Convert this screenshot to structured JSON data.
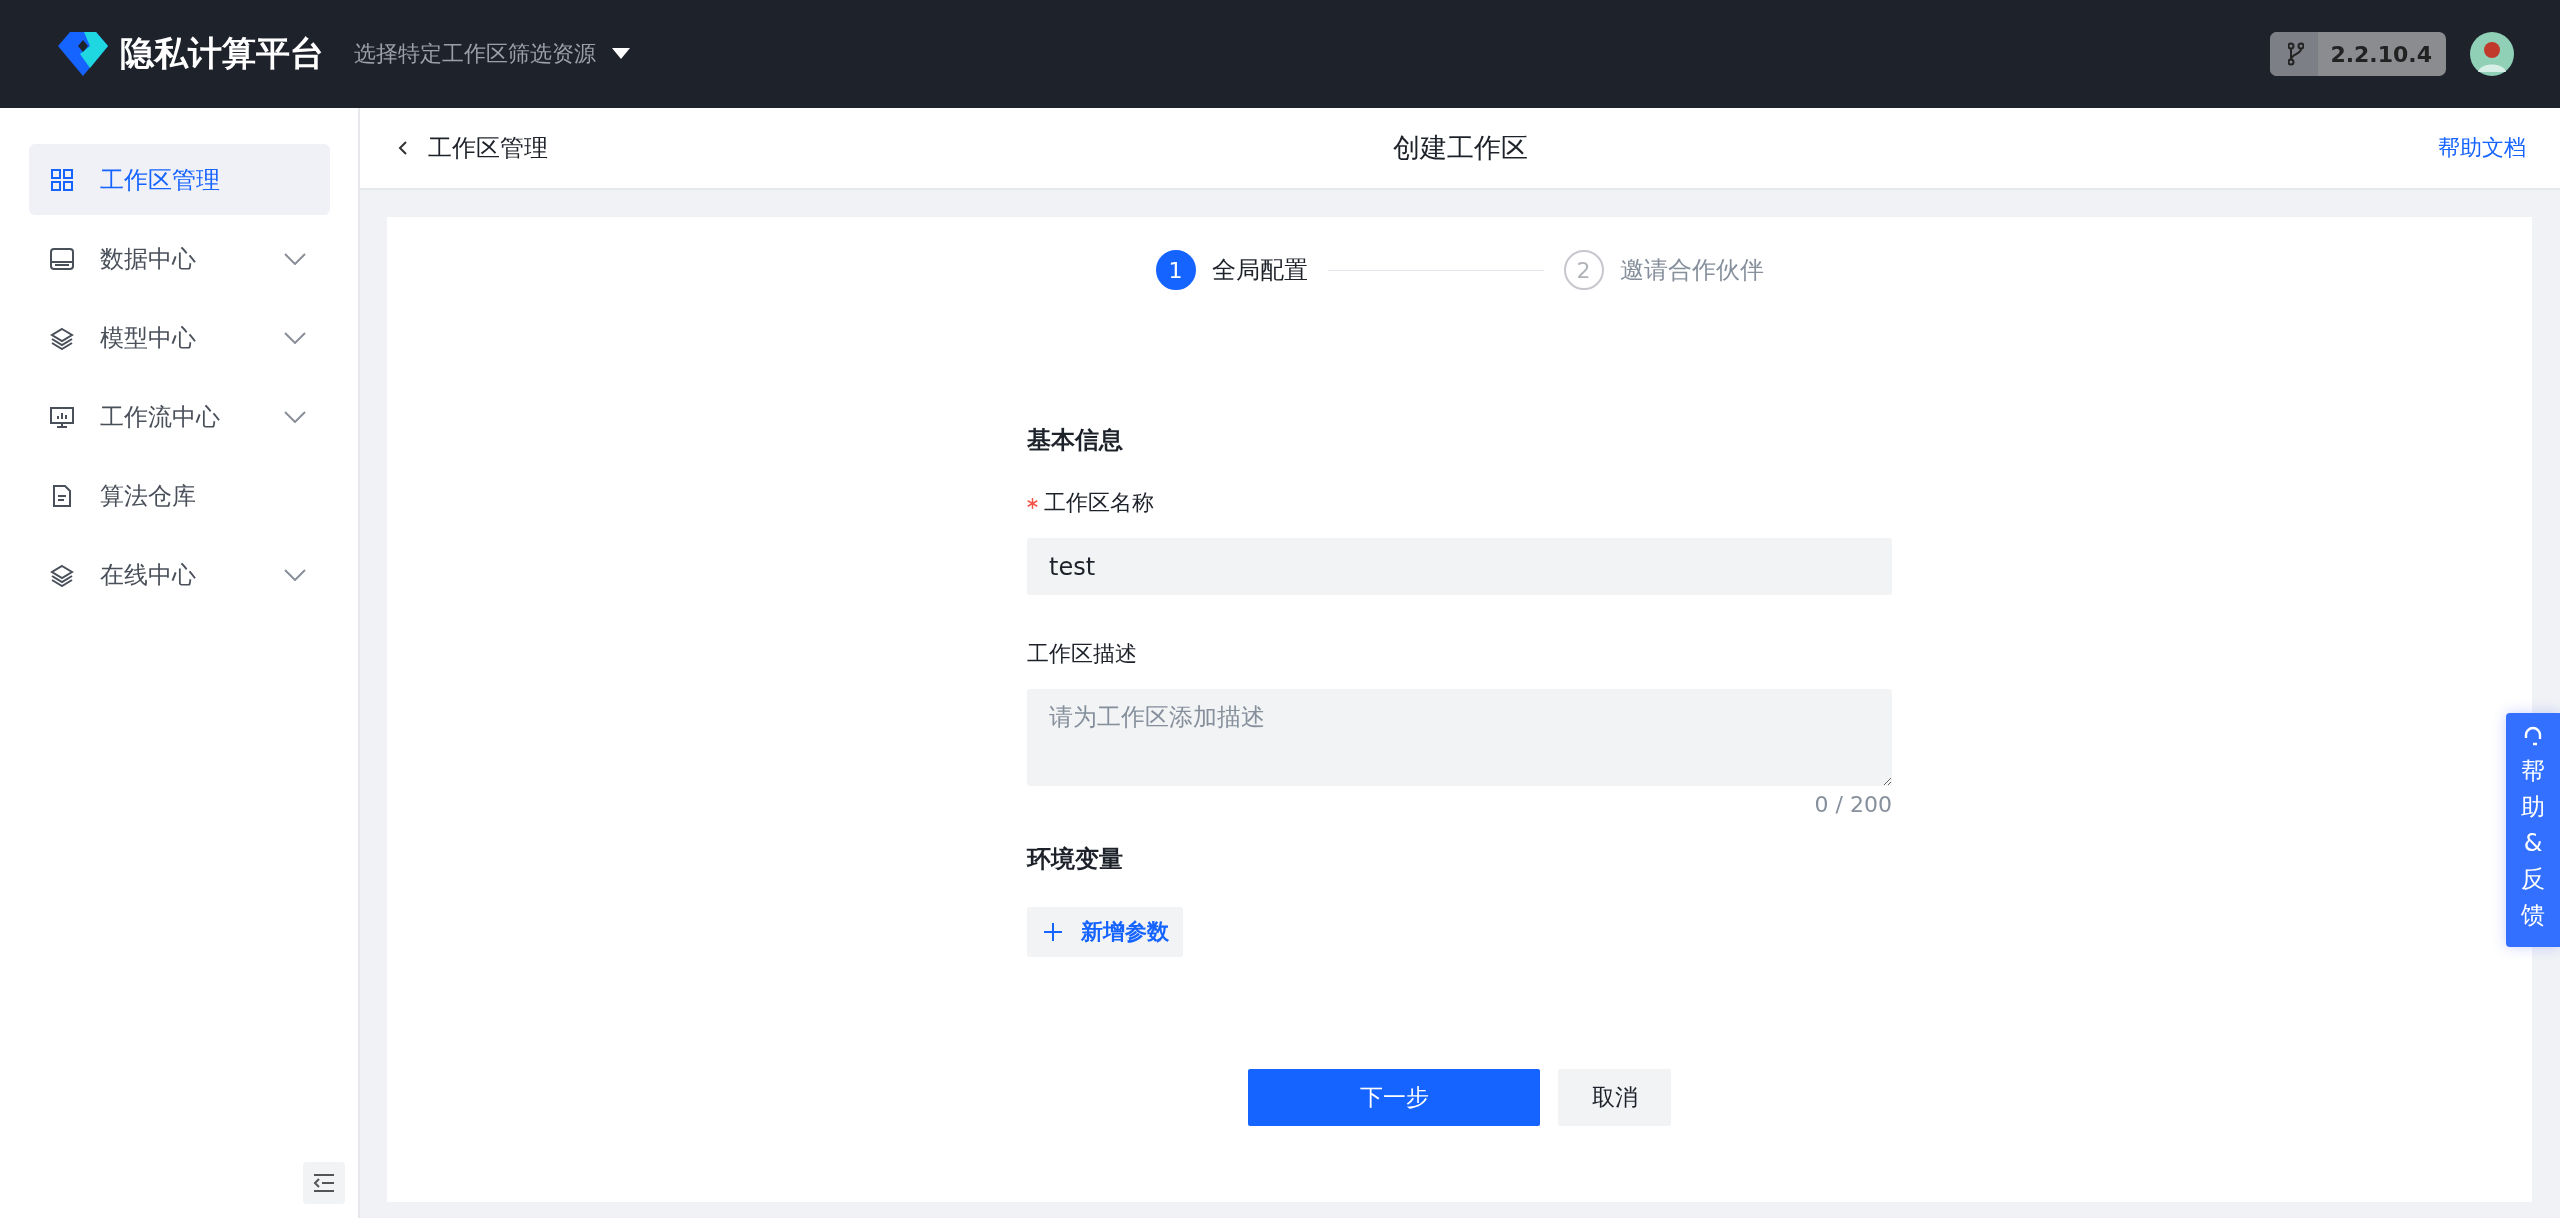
{
  "header": {
    "logo_text": "隐私计算平台",
    "workspace_filter": "选择特定工作区筛选资源",
    "version": "2.2.10.4"
  },
  "sidebar": {
    "items": [
      {
        "label": "工作区管理",
        "kind": "item",
        "selected": true
      },
      {
        "label": "数据中心",
        "kind": "submenu",
        "selected": false
      },
      {
        "label": "模型中心",
        "kind": "submenu",
        "selected": false
      },
      {
        "label": "工作流中心",
        "kind": "submenu",
        "selected": false
      },
      {
        "label": "算法仓库",
        "kind": "item",
        "selected": false
      },
      {
        "label": "在线中心",
        "kind": "submenu",
        "selected": false
      }
    ]
  },
  "page_header": {
    "back_label": "工作区管理",
    "title": "创建工作区",
    "help_link": "帮助文档"
  },
  "steps": [
    {
      "number": "1",
      "label": "全局配置",
      "selected": true
    },
    {
      "number": "2",
      "label": "邀请合作伙伴",
      "selected": false
    }
  ],
  "sections": [
    {
      "title": "基本信息",
      "fields": [
        {
          "label": "工作区名称",
          "kind": "input",
          "required": true,
          "value": "test"
        },
        {
          "label": "工作区描述",
          "kind": "textarea",
          "required": false,
          "placeholder": "请为工作区添加描述",
          "counter": "0 / 200"
        }
      ]
    },
    {
      "title": "环境变量",
      "add_button": "新增参数"
    }
  ],
  "actions": {
    "primary": "下一步",
    "secondary": "取消"
  },
  "feedback_tab": {
    "label": "帮助&反馈"
  }
}
